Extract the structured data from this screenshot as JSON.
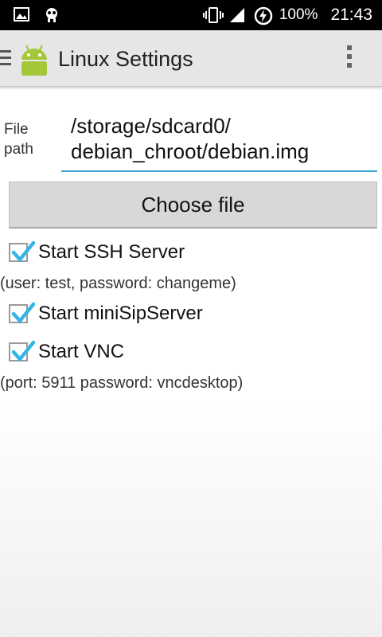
{
  "status_bar": {
    "battery_percent": "100%",
    "time": "21:43",
    "icons": [
      "image-icon",
      "android-debug-icon",
      "vibrate-icon",
      "signal-icon",
      "battery-charging-icon"
    ]
  },
  "action_bar": {
    "title": "Linux Settings",
    "icons": [
      "hamburger-icon",
      "android-app-icon",
      "overflow-menu-icon"
    ]
  },
  "file": {
    "label_line1": "File",
    "label_line2": "path",
    "value_line1": "/storage/sdcard0/",
    "value_line2": "debian_chroot/debian.img"
  },
  "choose_button": "Choose file",
  "options": [
    {
      "label": "Start SSH Server",
      "checked": true
    },
    {
      "label": "Start miniSipServer",
      "checked": true
    },
    {
      "label": "Start VNC",
      "checked": true
    }
  ],
  "notes": {
    "ssh": "(user: test, password: changeme)",
    "vnc": "(port: 5911 password: vncdesktop)"
  },
  "colors": {
    "accent": "#33b5e5",
    "status_bar_bg": "#000000",
    "action_bar_bg": "#e6e6e6",
    "android_green": "#a4c639"
  }
}
